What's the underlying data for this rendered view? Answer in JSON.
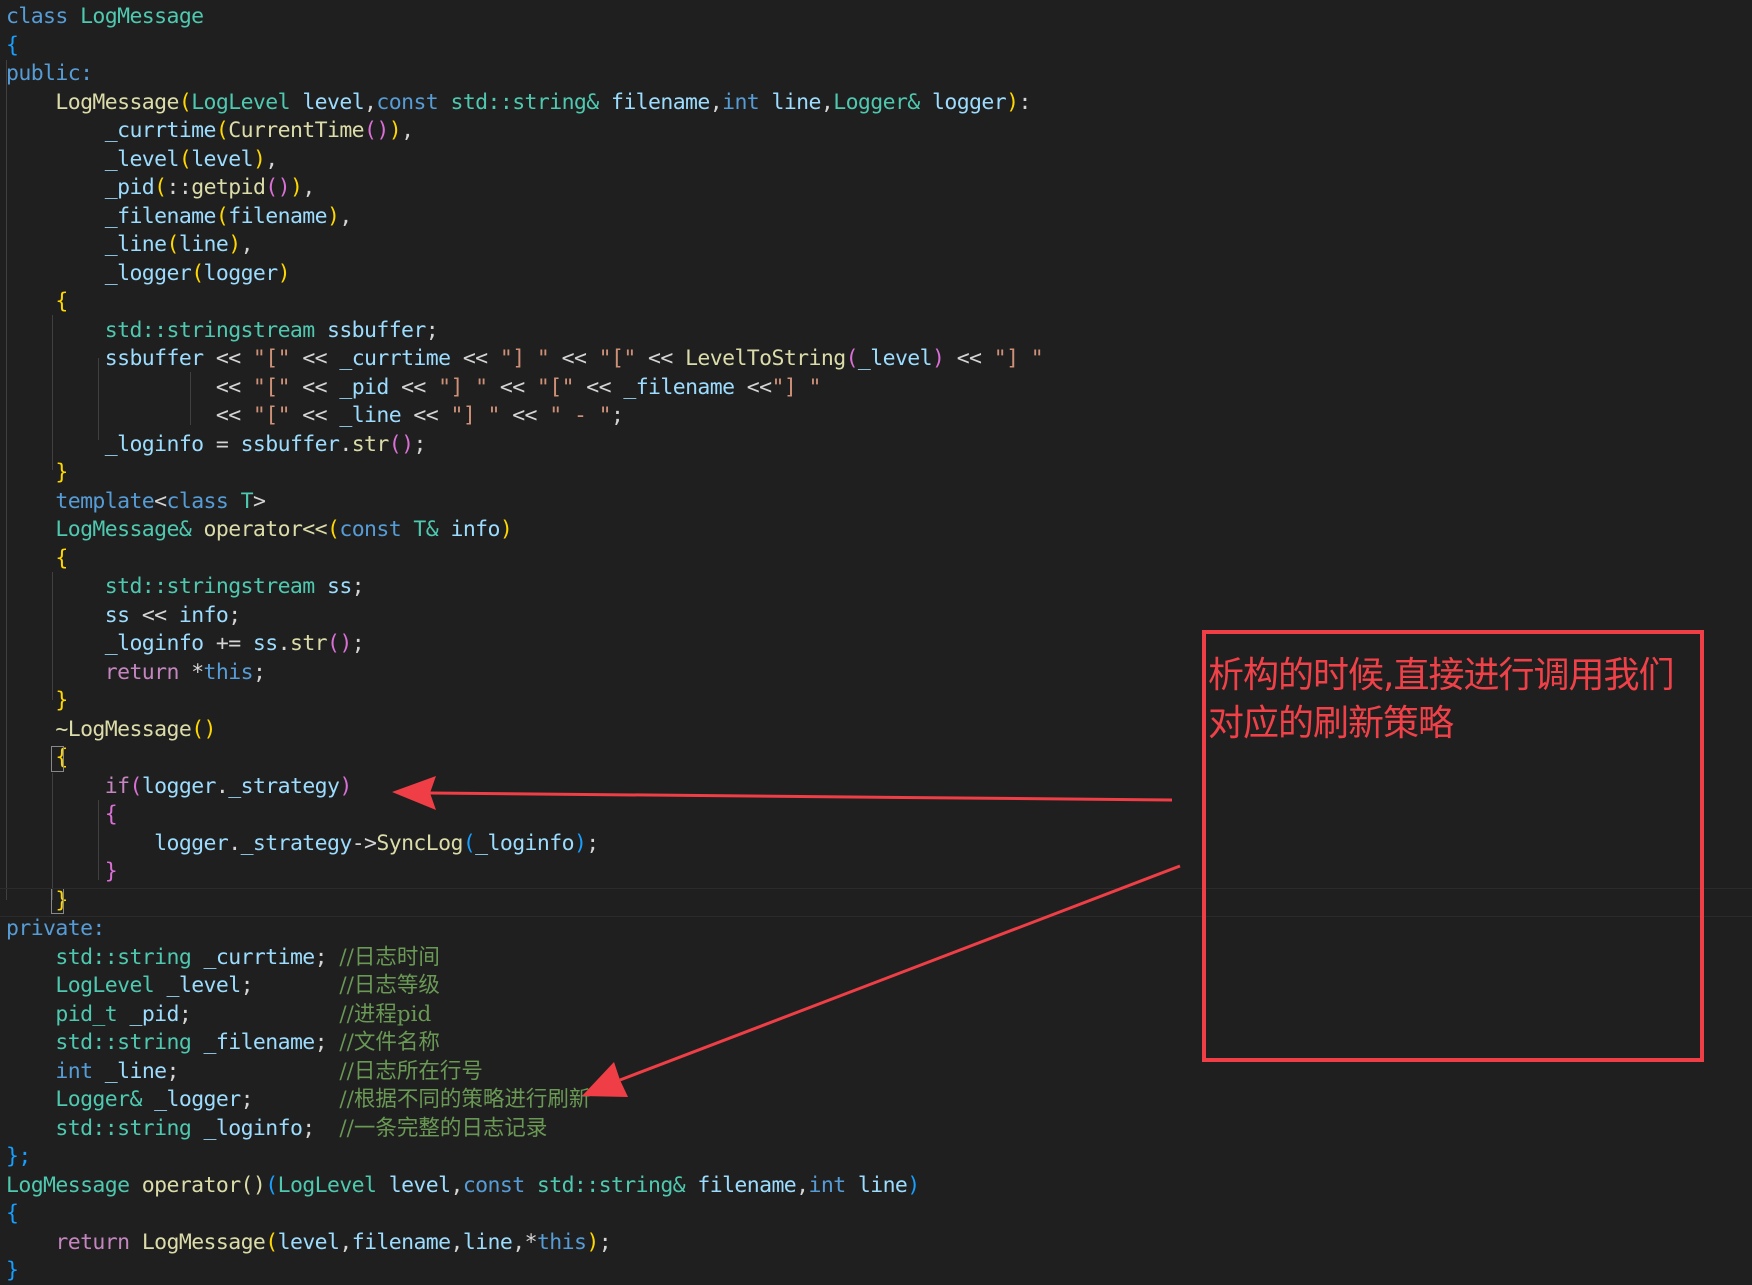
{
  "editor": {
    "lines": [
      {
        "tokens": [
          {
            "t": "class ",
            "c": "kw"
          },
          {
            "t": "LogMessage",
            "c": "ty"
          }
        ]
      },
      {
        "tokens": [
          {
            "t": "{",
            "c": "p3"
          }
        ]
      },
      {
        "tokens": [
          {
            "t": "public:",
            "c": "kw"
          }
        ]
      },
      {
        "tokens": [
          {
            "t": "    "
          },
          {
            "t": "LogMessage",
            "c": "fn"
          },
          {
            "t": "(",
            "c": "p1"
          },
          {
            "t": "LogLevel ",
            "c": "ty"
          },
          {
            "t": "level",
            "c": "vr"
          },
          {
            "t": ","
          },
          {
            "t": "const ",
            "c": "kw"
          },
          {
            "t": "std::string& ",
            "c": "ty"
          },
          {
            "t": "filename",
            "c": "vr"
          },
          {
            "t": ","
          },
          {
            "t": "int ",
            "c": "kw"
          },
          {
            "t": "line",
            "c": "vr"
          },
          {
            "t": ","
          },
          {
            "t": "Logger& ",
            "c": "ty"
          },
          {
            "t": "logger",
            "c": "vr"
          },
          {
            "t": ")",
            "c": "p1"
          },
          {
            "t": ":"
          }
        ]
      },
      {
        "tokens": [
          {
            "t": "        "
          },
          {
            "t": "_currtime",
            "c": "vr"
          },
          {
            "t": "(",
            "c": "p1"
          },
          {
            "t": "CurrentTime",
            "c": "fn"
          },
          {
            "t": "()",
            "c": "p2"
          },
          {
            "t": ")",
            "c": "p1"
          },
          {
            "t": ","
          }
        ]
      },
      {
        "tokens": [
          {
            "t": "        "
          },
          {
            "t": "_level",
            "c": "vr"
          },
          {
            "t": "(",
            "c": "p1"
          },
          {
            "t": "level",
            "c": "vr"
          },
          {
            "t": ")",
            "c": "p1"
          },
          {
            "t": ","
          }
        ]
      },
      {
        "tokens": [
          {
            "t": "        "
          },
          {
            "t": "_pid",
            "c": "vr"
          },
          {
            "t": "(",
            "c": "p1"
          },
          {
            "t": "::",
            "c": "pl"
          },
          {
            "t": "getpid",
            "c": "fn"
          },
          {
            "t": "()",
            "c": "p2"
          },
          {
            "t": ")",
            "c": "p1"
          },
          {
            "t": ","
          }
        ]
      },
      {
        "tokens": [
          {
            "t": "        "
          },
          {
            "t": "_filename",
            "c": "vr"
          },
          {
            "t": "(",
            "c": "p1"
          },
          {
            "t": "filename",
            "c": "vr"
          },
          {
            "t": ")",
            "c": "p1"
          },
          {
            "t": ","
          }
        ]
      },
      {
        "tokens": [
          {
            "t": "        "
          },
          {
            "t": "_line",
            "c": "vr"
          },
          {
            "t": "(",
            "c": "p1"
          },
          {
            "t": "line",
            "c": "vr"
          },
          {
            "t": ")",
            "c": "p1"
          },
          {
            "t": ","
          }
        ]
      },
      {
        "tokens": [
          {
            "t": "        "
          },
          {
            "t": "_logger",
            "c": "vr"
          },
          {
            "t": "(",
            "c": "p1"
          },
          {
            "t": "logger",
            "c": "vr"
          },
          {
            "t": ")",
            "c": "p1"
          }
        ]
      },
      {
        "tokens": [
          {
            "t": "    "
          },
          {
            "t": "{",
            "c": "p1"
          }
        ]
      },
      {
        "tokens": [
          {
            "t": "        "
          },
          {
            "t": "std::stringstream ",
            "c": "ty"
          },
          {
            "t": "ssbuffer",
            "c": "vr"
          },
          {
            "t": ";"
          }
        ]
      },
      {
        "tokens": [
          {
            "t": "        "
          },
          {
            "t": "ssbuffer",
            "c": "vr"
          },
          {
            "t": " << "
          },
          {
            "t": "\"[\"",
            "c": "st"
          },
          {
            "t": " << "
          },
          {
            "t": "_currtime",
            "c": "vr"
          },
          {
            "t": " << "
          },
          {
            "t": "\"] \"",
            "c": "st"
          },
          {
            "t": " << "
          },
          {
            "t": "\"[\"",
            "c": "st"
          },
          {
            "t": " << "
          },
          {
            "t": "LevelToString",
            "c": "fn"
          },
          {
            "t": "(",
            "c": "p2"
          },
          {
            "t": "_level",
            "c": "vr"
          },
          {
            "t": ")",
            "c": "p2"
          },
          {
            "t": " << "
          },
          {
            "t": "\"] \"",
            "c": "st"
          }
        ]
      },
      {
        "tokens": [
          {
            "t": "                 "
          },
          {
            "t": "<< "
          },
          {
            "t": "\"[\"",
            "c": "st"
          },
          {
            "t": " << "
          },
          {
            "t": "_pid",
            "c": "vr"
          },
          {
            "t": " << "
          },
          {
            "t": "\"] \"",
            "c": "st"
          },
          {
            "t": " << "
          },
          {
            "t": "\"[\"",
            "c": "st"
          },
          {
            "t": " << "
          },
          {
            "t": "_filename",
            "c": "vr"
          },
          {
            "t": " <<"
          },
          {
            "t": "\"] \"",
            "c": "st"
          }
        ]
      },
      {
        "tokens": [
          {
            "t": "                 "
          },
          {
            "t": "<< "
          },
          {
            "t": "\"[\"",
            "c": "st"
          },
          {
            "t": " << "
          },
          {
            "t": "_line",
            "c": "vr"
          },
          {
            "t": " << "
          },
          {
            "t": "\"] \"",
            "c": "st"
          },
          {
            "t": " << "
          },
          {
            "t": "\" - \"",
            "c": "st"
          },
          {
            "t": ";"
          }
        ]
      },
      {
        "tokens": [
          {
            "t": "        "
          },
          {
            "t": "_loginfo",
            "c": "vr"
          },
          {
            "t": " = "
          },
          {
            "t": "ssbuffer",
            "c": "vr"
          },
          {
            "t": "."
          },
          {
            "t": "str",
            "c": "fn"
          },
          {
            "t": "()",
            "c": "p2"
          },
          {
            "t": ";"
          }
        ]
      },
      {
        "tokens": [
          {
            "t": "    "
          },
          {
            "t": "}",
            "c": "p1"
          }
        ]
      },
      {
        "tokens": [
          {
            "t": "    "
          },
          {
            "t": "template",
            "c": "kw"
          },
          {
            "t": "<",
            "c": "pl"
          },
          {
            "t": "class ",
            "c": "kw"
          },
          {
            "t": "T",
            "c": "ty"
          },
          {
            "t": ">",
            "c": "pl"
          }
        ]
      },
      {
        "tokens": [
          {
            "t": "    "
          },
          {
            "t": "LogMessage& ",
            "c": "ty"
          },
          {
            "t": "operator<<",
            "c": "fn"
          },
          {
            "t": "(",
            "c": "p1"
          },
          {
            "t": "const ",
            "c": "kw"
          },
          {
            "t": "T& ",
            "c": "ty"
          },
          {
            "t": "info",
            "c": "vr"
          },
          {
            "t": ")",
            "c": "p1"
          }
        ]
      },
      {
        "tokens": [
          {
            "t": "    "
          },
          {
            "t": "{",
            "c": "p1"
          }
        ]
      },
      {
        "tokens": [
          {
            "t": "        "
          },
          {
            "t": "std::stringstream ",
            "c": "ty"
          },
          {
            "t": "ss",
            "c": "vr"
          },
          {
            "t": ";"
          }
        ]
      },
      {
        "tokens": [
          {
            "t": "        "
          },
          {
            "t": "ss",
            "c": "vr"
          },
          {
            "t": " << "
          },
          {
            "t": "info",
            "c": "vr"
          },
          {
            "t": ";"
          }
        ]
      },
      {
        "tokens": [
          {
            "t": "        "
          },
          {
            "t": "_loginfo",
            "c": "vr"
          },
          {
            "t": " += "
          },
          {
            "t": "ss",
            "c": "vr"
          },
          {
            "t": "."
          },
          {
            "t": "str",
            "c": "fn"
          },
          {
            "t": "()",
            "c": "p2"
          },
          {
            "t": ";"
          }
        ]
      },
      {
        "tokens": [
          {
            "t": "        "
          },
          {
            "t": "return ",
            "c": "cf"
          },
          {
            "t": "*"
          },
          {
            "t": "this",
            "c": "kw"
          },
          {
            "t": ";"
          }
        ]
      },
      {
        "tokens": [
          {
            "t": "    "
          },
          {
            "t": "}",
            "c": "p1"
          }
        ]
      },
      {
        "tokens": [
          {
            "t": "    "
          },
          {
            "t": "~LogMessage",
            "c": "fn"
          },
          {
            "t": "()",
            "c": "p1"
          }
        ]
      },
      {
        "tokens": [
          {
            "t": "    "
          },
          {
            "t": "{",
            "c": "p1"
          }
        ]
      },
      {
        "tokens": [
          {
            "t": "        "
          },
          {
            "t": "if",
            "c": "cf"
          },
          {
            "t": "(",
            "c": "p2"
          },
          {
            "t": "logger",
            "c": "vr"
          },
          {
            "t": "."
          },
          {
            "t": "_strategy",
            "c": "vr"
          },
          {
            "t": ")",
            "c": "p2"
          }
        ]
      },
      {
        "tokens": [
          {
            "t": "        "
          },
          {
            "t": "{",
            "c": "p2"
          }
        ]
      },
      {
        "tokens": [
          {
            "t": "            "
          },
          {
            "t": "logger",
            "c": "vr"
          },
          {
            "t": "."
          },
          {
            "t": "_strategy",
            "c": "vr"
          },
          {
            "t": "->"
          },
          {
            "t": "SyncLog",
            "c": "fn"
          },
          {
            "t": "(",
            "c": "p3"
          },
          {
            "t": "_loginfo",
            "c": "vr"
          },
          {
            "t": ")",
            "c": "p3"
          },
          {
            "t": ";"
          }
        ]
      },
      {
        "tokens": [
          {
            "t": "        "
          },
          {
            "t": "}",
            "c": "p2"
          }
        ]
      },
      {
        "tokens": [
          {
            "t": "    "
          },
          {
            "t": "}",
            "c": "p1"
          }
        ]
      },
      {
        "tokens": [
          {
            "t": "private:",
            "c": "kw"
          }
        ]
      },
      {
        "tokens": [
          {
            "t": "    "
          },
          {
            "t": "std::string ",
            "c": "ty"
          },
          {
            "t": "_currtime",
            "c": "vr"
          },
          {
            "t": "; "
          },
          {
            "t": "//日志时间",
            "c": "cm"
          }
        ]
      },
      {
        "tokens": [
          {
            "t": "    "
          },
          {
            "t": "LogLevel ",
            "c": "ty"
          },
          {
            "t": "_level",
            "c": "vr"
          },
          {
            "t": ";       "
          },
          {
            "t": "//日志等级",
            "c": "cm"
          }
        ]
      },
      {
        "tokens": [
          {
            "t": "    "
          },
          {
            "t": "pid_t ",
            "c": "ty"
          },
          {
            "t": "_pid",
            "c": "vr"
          },
          {
            "t": ";            "
          },
          {
            "t": "//进程pid",
            "c": "cm"
          }
        ]
      },
      {
        "tokens": [
          {
            "t": "    "
          },
          {
            "t": "std::string ",
            "c": "ty"
          },
          {
            "t": "_filename",
            "c": "vr"
          },
          {
            "t": "; "
          },
          {
            "t": "//文件名称",
            "c": "cm"
          }
        ]
      },
      {
        "tokens": [
          {
            "t": "    "
          },
          {
            "t": "int ",
            "c": "kw"
          },
          {
            "t": "_line",
            "c": "vr"
          },
          {
            "t": ";             "
          },
          {
            "t": "//日志所在行号",
            "c": "cm"
          }
        ]
      },
      {
        "tokens": [
          {
            "t": "    "
          },
          {
            "t": "Logger& ",
            "c": "ty"
          },
          {
            "t": "_logger",
            "c": "vr"
          },
          {
            "t": ";       "
          },
          {
            "t": "//根据不同的策略进行刷新",
            "c": "cm"
          }
        ]
      },
      {
        "tokens": [
          {
            "t": "    "
          },
          {
            "t": "std::string ",
            "c": "ty"
          },
          {
            "t": "_loginfo",
            "c": "vr"
          },
          {
            "t": ";  "
          },
          {
            "t": "//一条完整的日志记录",
            "c": "cm"
          }
        ]
      },
      {
        "tokens": [
          {
            "t": "};",
            "c": "p3"
          }
        ]
      },
      {
        "tokens": [
          {
            "t": "LogMessage ",
            "c": "ty"
          },
          {
            "t": "operator()",
            "c": "fn"
          },
          {
            "t": "(",
            "c": "p3"
          },
          {
            "t": "LogLevel ",
            "c": "ty"
          },
          {
            "t": "level",
            "c": "vr"
          },
          {
            "t": ","
          },
          {
            "t": "const ",
            "c": "kw"
          },
          {
            "t": "std::string& ",
            "c": "ty"
          },
          {
            "t": "filename",
            "c": "vr"
          },
          {
            "t": ","
          },
          {
            "t": "int ",
            "c": "kw"
          },
          {
            "t": "line",
            "c": "vr"
          },
          {
            "t": ")",
            "c": "p3"
          }
        ]
      },
      {
        "tokens": [
          {
            "t": "{",
            "c": "p3"
          }
        ]
      },
      {
        "tokens": [
          {
            "t": "    "
          },
          {
            "t": "return ",
            "c": "cf"
          },
          {
            "t": "LogMessage",
            "c": "fn"
          },
          {
            "t": "(",
            "c": "p1"
          },
          {
            "t": "level",
            "c": "vr"
          },
          {
            "t": ","
          },
          {
            "t": "filename",
            "c": "vr"
          },
          {
            "t": ","
          },
          {
            "t": "line",
            "c": "vr"
          },
          {
            "t": ","
          },
          {
            "t": "*"
          },
          {
            "t": "this",
            "c": "kw"
          },
          {
            "t": ")",
            "c": "p1"
          },
          {
            "t": ";"
          }
        ]
      },
      {
        "tokens": [
          {
            "t": "}",
            "c": "p3"
          }
        ]
      }
    ]
  },
  "annotation": {
    "text": "析构的时候,直接进行调用我们对应的刷新策略",
    "color": "#ef3e45"
  }
}
